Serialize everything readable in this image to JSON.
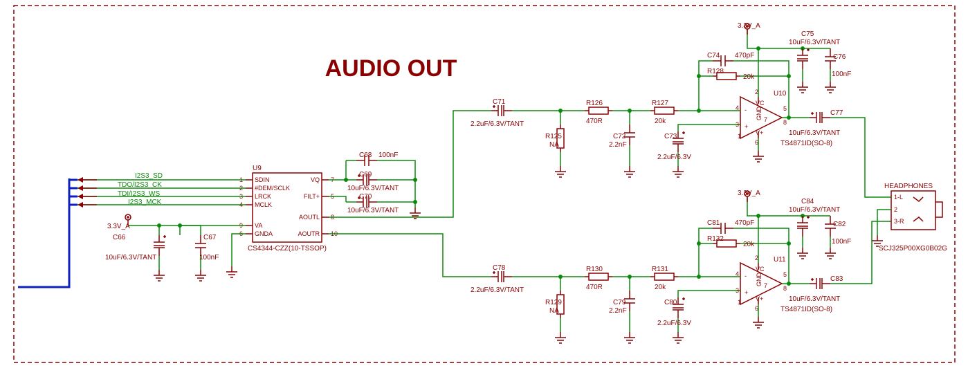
{
  "title": "AUDIO OUT",
  "power_rail": "3.3V_A",
  "signals": {
    "sd": "I2S3_SD",
    "ck": "TDO/I2S3_CK",
    "ws": "TDI/I2S3_WS",
    "mck": "I2S3_MCK"
  },
  "dac": {
    "ref": "U9",
    "part": "CS4344-CZZ(10-TSSOP)",
    "pins": {
      "p1": "SDIN",
      "p2": "#DEM/SCLK",
      "p3": "LRCK",
      "p4": "MCLK",
      "p5": "FILT+",
      "p6": "GNDA",
      "p7": "VQ",
      "p8": "AOUTL",
      "p9": "VA",
      "p10": "AOUTR"
    }
  },
  "dac_caps": {
    "c66": {
      "ref": "C66",
      "val": "10uF/6.3V/TANT"
    },
    "c67": {
      "ref": "C67",
      "val": "100nF"
    },
    "c68": {
      "ref": "C68",
      "val": "100nF"
    },
    "c69": {
      "ref": "C69",
      "val": "10uF/6.3V/TANT"
    },
    "c70": {
      "ref": "C70",
      "val": "10uF/6.3V/TANT"
    }
  },
  "ch_top": {
    "coupling": {
      "ref": "C71",
      "val": "2.2uF/6.3V/TANT"
    },
    "r_in_series": {
      "ref": "R126",
      "val": "470R"
    },
    "r_in_shunt": {
      "ref": "R125",
      "val": "NA"
    },
    "r_gain": {
      "ref": "R127",
      "val": "20k"
    },
    "c_in_shunt": {
      "ref": "C72",
      "val": "2.2nF"
    },
    "c_byp": {
      "ref": "C73",
      "val": "2.2uF/6.3V"
    },
    "c_fb": {
      "ref": "C74",
      "val": "470pF"
    },
    "r_fb": {
      "ref": "R128",
      "val": "20k"
    },
    "c_vcc_tant": {
      "ref": "C75",
      "val": "10uF/6.3V/TANT"
    },
    "c_vcc_100n": {
      "ref": "C76",
      "val": "100nF"
    },
    "c_out": {
      "ref": "C77",
      "val": "10uF/6.3V/TANT"
    },
    "amp": {
      "ref": "U10",
      "part": "TS4871ID(SO-8)"
    }
  },
  "ch_bot": {
    "coupling": {
      "ref": "C78",
      "val": "2.2uF/6.3V/TANT"
    },
    "r_in_series": {
      "ref": "R130",
      "val": "470R"
    },
    "r_in_shunt": {
      "ref": "R129",
      "val": "NA"
    },
    "r_gain": {
      "ref": "R131",
      "val": "20k"
    },
    "c_in_shunt": {
      "ref": "C79",
      "val": "2.2nF"
    },
    "c_byp": {
      "ref": "C80",
      "val": "2.2uF/6.3V"
    },
    "c_fb": {
      "ref": "C81",
      "val": "470pF"
    },
    "r_fb": {
      "ref": "R132",
      "val": "20k"
    },
    "c_vcc_tant": {
      "ref": "C84",
      "val": "10uF/6.3V/TANT"
    },
    "c_vcc_100n": {
      "ref": "C82",
      "val": "100nF"
    },
    "c_out": {
      "ref": "C83",
      "val": "10uF/6.3V/TANT"
    },
    "amp": {
      "ref": "U11",
      "part": "TS4871ID(SO-8)"
    }
  },
  "jack": {
    "label": "HEADPHONES",
    "part": "SCJ325P00XG0B02G",
    "pins": {
      "p1": "1-L",
      "p2": "2",
      "p3": "3-R"
    }
  },
  "amp_pins": {
    "vc": "VC",
    "vp": "V+",
    "in_p": "+",
    "in_n": "-",
    "gnd": "GND",
    "pin1": "1",
    "pin2": "2",
    "pin3": "3",
    "pin4": "4",
    "pin5": "5",
    "pin6": "6",
    "pin7": "7",
    "pin8": "8"
  }
}
